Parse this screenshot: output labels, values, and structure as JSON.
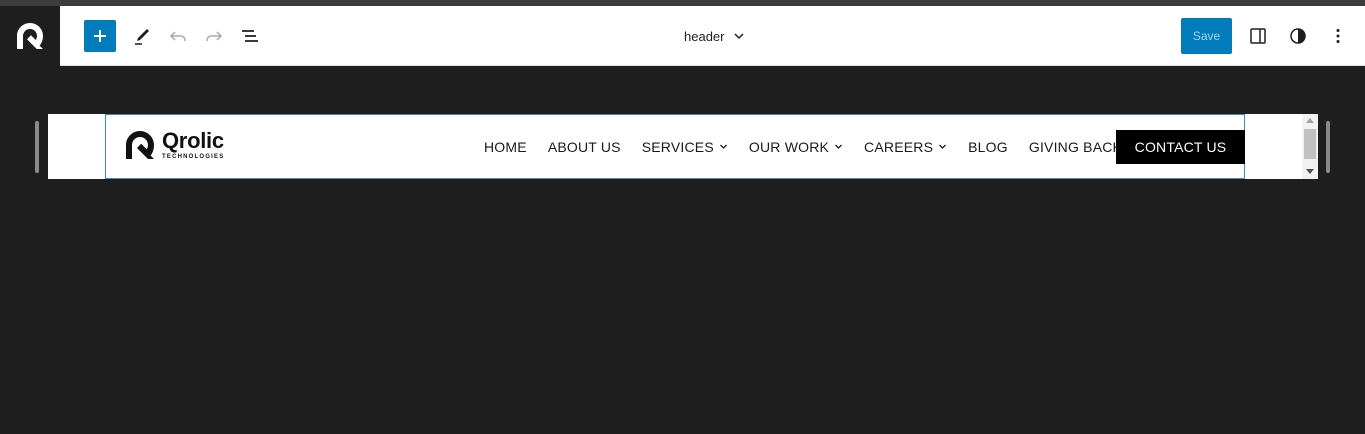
{
  "toolbar": {
    "doc_title": "header",
    "save_label": "Save",
    "icons": {
      "site": "site-logo-icon",
      "add": "plus-icon",
      "edit": "pencil-icon",
      "undo": "undo-icon",
      "redo": "redo-icon",
      "list_view": "list-view-icon",
      "title_dropdown": "chevron-down-icon",
      "settings": "sidebar-toggle-icon",
      "styles": "half-circle-contrast-icon",
      "more": "vertical-ellipsis-icon"
    }
  },
  "preview": {
    "logo": {
      "name": "Qrolic",
      "subtitle": "TECHNOLOGIES"
    },
    "nav": [
      {
        "label": "HOME",
        "has_dropdown": false
      },
      {
        "label": "ABOUT US",
        "has_dropdown": false
      },
      {
        "label": "SERVICES",
        "has_dropdown": true
      },
      {
        "label": "OUR WORK",
        "has_dropdown": true
      },
      {
        "label": "CAREERS",
        "has_dropdown": true
      },
      {
        "label": "BLOG",
        "has_dropdown": false
      },
      {
        "label": "GIVING BACK",
        "has_dropdown": false
      }
    ],
    "contact_label": "CONTACT US"
  },
  "colors": {
    "accent": "#007cba",
    "editor_bg": "#1e1e1e",
    "block_outline": "#3e8cc4",
    "contact_bg": "#000000"
  }
}
